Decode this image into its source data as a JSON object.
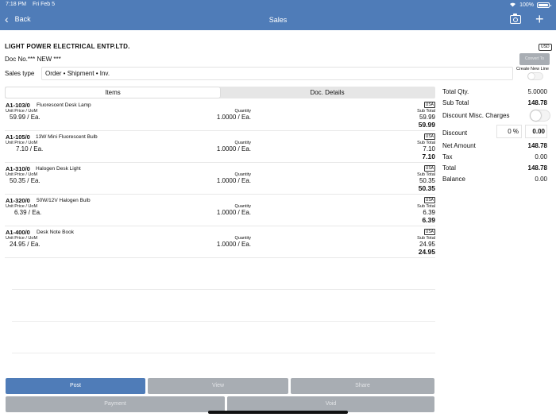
{
  "status": {
    "time": "7:18 PM",
    "date": "Fri Feb 5",
    "battery": "100%"
  },
  "nav": {
    "back_label": "Back",
    "title": "Sales"
  },
  "header": {
    "company": "LIGHT  POWER ELECTRICAL ENTP.LTD.",
    "currency": "USD",
    "doc_no": "Doc No.*** NEW ***",
    "convert_button": "Convert To",
    "create_new_line": "Create New Line",
    "sales_type_label": "Sales type",
    "sales_type_value": "Order • Shipment • Inv."
  },
  "tabs": [
    {
      "label": "Items"
    },
    {
      "label": "Doc. Details"
    }
  ],
  "item_labels": {
    "unit_price": "Unit Price / UoM",
    "quantity": "Quantity",
    "sub_total": "Sub Total"
  },
  "items": [
    {
      "code": "A1-103/0",
      "desc": "Fluorescent Desk Lamp",
      "origin": "USA",
      "price": "59.99 / Ea.",
      "qty": "1.0000 / Ea.",
      "subtotal": "59.99",
      "total": "59.99"
    },
    {
      "code": "A1-105/0",
      "desc": "13W Mini Fluorescent Bulb",
      "origin": "USA",
      "price": "7.10 / Ea.",
      "qty": "1.0000 / Ea.",
      "subtotal": "7.10",
      "total": "7.10"
    },
    {
      "code": "A1-310/0",
      "desc": "Halogen Desk Light",
      "origin": "USA",
      "price": "50.35 / Ea.",
      "qty": "1.0000 / Ea.",
      "subtotal": "50.35",
      "total": "50.35"
    },
    {
      "code": "A1-320/0",
      "desc": "50W/12V Halogen Bulb",
      "origin": "USA",
      "price": "6.39 / Ea.",
      "qty": "1.0000 / Ea.",
      "subtotal": "6.39",
      "total": "6.39"
    },
    {
      "code": "A1-400/0",
      "desc": "Desk Note Book",
      "origin": "USA",
      "price": "24.95 / Ea.",
      "qty": "1.0000 / Ea.",
      "subtotal": "24.95",
      "total": "24.95"
    }
  ],
  "summary": {
    "total_qty_label": "Total Qty.",
    "total_qty": "5.0000",
    "sub_total_label": "Sub Total",
    "sub_total": "148.78",
    "misc_label": "Discount Misc. Charges",
    "discount_label": "Discount",
    "discount_pct": "0",
    "pct_sign": "%",
    "discount_value": "0.00",
    "net_label": "Net Amount",
    "net": "148.78",
    "tax_label": "Tax",
    "tax": "0.00",
    "total_label": "Total",
    "total": "148.78",
    "balance_label": "Balance",
    "balance": "0.00"
  },
  "buttons": {
    "post": "Post",
    "view": "View",
    "share": "Share",
    "payment": "Payment",
    "void": "Void"
  },
  "colors": {
    "accent": "#4f7cb8",
    "disabled": "#a8adb3"
  }
}
